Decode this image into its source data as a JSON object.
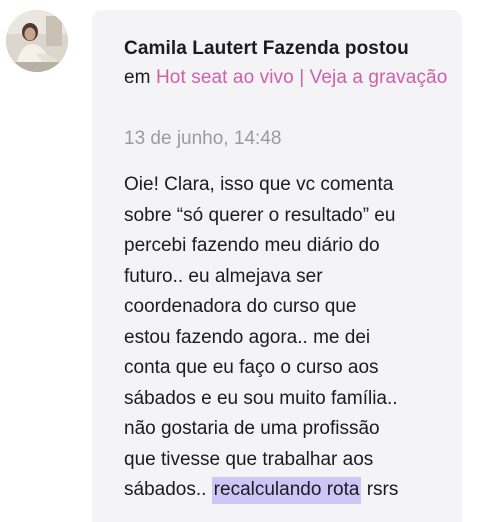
{
  "post": {
    "author": "Camila Lautert Fazenda",
    "action": " postou",
    "in_word": "em ",
    "context_link": "Hot seat ao vivo | Veja a gravação",
    "timestamp": "13 de junho, 14:48",
    "body_lines": [
      "Oie! Clara, isso que vc comenta",
      "sobre “só querer o resultado” eu",
      "percebi fazendo meu diário do",
      "futuro.. eu almejava ser",
      "coordenadora do curso que",
      "estou fazendo agora.. me dei",
      "conta que eu faço o curso aos",
      "sábados e eu sou muito família..",
      "não gostaria de uma profissão",
      "que tivesse que trabalhar aos"
    ],
    "last_line_prefix": "sábados.. ",
    "highlighted_text": "recalculando rota",
    "last_line_suffix": " rsrs"
  },
  "colors": {
    "card_background": "#f4f4f6",
    "link": "#cf5fab",
    "timestamp": "#9a9aa0",
    "highlight": "#cdc6f7",
    "text": "#1c1c1e"
  },
  "icons": {
    "avatar": "user-avatar-photo"
  }
}
